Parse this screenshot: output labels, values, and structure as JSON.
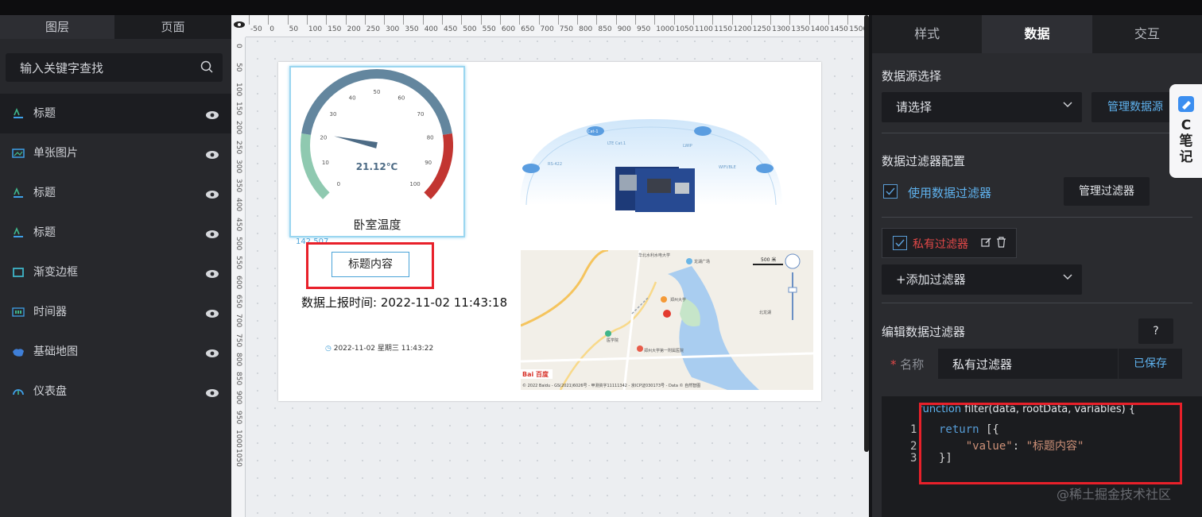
{
  "left_panel": {
    "tabs": [
      "图层",
      "页面"
    ],
    "search_placeholder": "输入关键字查找",
    "layers": [
      {
        "label": "标题",
        "icon": "title-icon"
      },
      {
        "label": "单张图片",
        "icon": "image-icon"
      },
      {
        "label": "标题",
        "icon": "title-icon"
      },
      {
        "label": "标题",
        "icon": "title-icon"
      },
      {
        "label": "渐变边框",
        "icon": "border-icon"
      },
      {
        "label": "时间器",
        "icon": "timer-icon"
      },
      {
        "label": "基础地图",
        "icon": "map-icon"
      },
      {
        "label": "仪表盘",
        "icon": "gauge-icon"
      }
    ]
  },
  "canvas": {
    "ruler_top_labels": [
      "-50",
      "0",
      "50",
      "100",
      "150",
      "200",
      "250",
      "300",
      "350",
      "400",
      "450",
      "500",
      "550",
      "600",
      "650",
      "700",
      "750",
      "800",
      "850",
      "900",
      "950",
      "1000",
      "1050",
      "1100",
      "1150",
      "1200",
      "1250",
      "1300",
      "1350",
      "1400",
      "1450",
      "1500"
    ],
    "ruler_left_labels": [
      "0",
      "50",
      "100",
      "150",
      "200",
      "250",
      "300",
      "350",
      "400",
      "450",
      "500",
      "550",
      "600",
      "650",
      "700",
      "750",
      "800",
      "850",
      "900",
      "950",
      "1000",
      "1050"
    ],
    "gauge": {
      "value_text": "21.12℃",
      "value": 21.12,
      "min": 0,
      "max": 100,
      "ticks": [
        "0",
        "10",
        "20",
        "30",
        "40",
        "50",
        "60",
        "70",
        "80",
        "90",
        "100"
      ],
      "title": "卧室温度",
      "colors": {
        "low": "#8fc9b0",
        "mid": "#63869e",
        "high": "#c23531"
      }
    },
    "coord_label": "142,507",
    "title_widget": "标题内容",
    "report_time": "数据上报时间: 2022-11-02 11:43:18",
    "clock_text": "2022-11-02 星期三 11:43:22",
    "iot_labels": [
      "Cat-1",
      "LTE Cat.1",
      "LWIP",
      "RS-422",
      "WIFI/BLE"
    ],
    "map": {
      "scale": "500 米",
      "copyright": "© 2022 Baidu - GS(2021)6026号 - 甲测资字11111342 - 京ICP证030173号 - Data © 自然智图",
      "logo": "Bai 百度",
      "places": [
        "华北水利水电大学",
        "龙湖广场",
        "郑州大学",
        "医学院",
        "北龙湖",
        "郑州大学第一附属医院"
      ]
    }
  },
  "right_panel": {
    "tabs": [
      "样式",
      "数据",
      "交互"
    ],
    "active_tab": "数据",
    "datasource_label": "数据源选择",
    "datasource_value": "请选择",
    "manage_datasource": "管理数据源",
    "filter_config_label": "数据过滤器配置",
    "use_filter_label": "使用数据过滤器",
    "manage_filter": "管理过滤器",
    "private_filter": "私有过滤器",
    "add_filter": "+添加过滤器",
    "edit_filter_label": "编辑数据过滤器",
    "help": "?",
    "name_required": "*",
    "name_label": "名称",
    "name_value": "私有过滤器",
    "saved": "已保存",
    "code_header_kw": "function",
    "code_header_rest": " filter(data, rootData, variables) {",
    "code_lines": [
      {
        "n": "1",
        "text": "return [{"
      },
      {
        "n": "2",
        "text": "    \"value\": \"标题内容\""
      },
      {
        "n": "3",
        "text": "}]"
      }
    ],
    "watermark": "@稀土掘金技术社区"
  },
  "side_note": {
    "letter": "C",
    "text": "笔记"
  },
  "accent": "#5fb2ee",
  "highlight_red": "#e8202a"
}
